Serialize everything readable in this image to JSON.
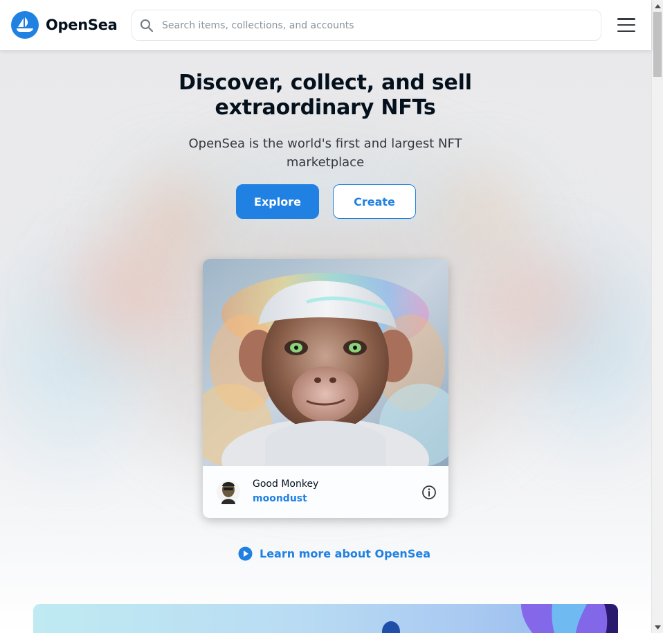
{
  "header": {
    "brand": "OpenSea",
    "search_placeholder": "Search items, collections, and accounts",
    "menu_icon": "hamburger-menu-icon",
    "logo_icon": "opensea-sailboat-icon"
  },
  "hero": {
    "title": "Discover, collect, and sell extraordinary NFTs",
    "subtitle": "OpenSea is the world's first and largest NFT marketplace",
    "explore_label": "Explore",
    "create_label": "Create"
  },
  "featured": {
    "name": "Good Monkey",
    "creator": "moondust",
    "info_icon": "info-icon"
  },
  "learn_more": {
    "label": "Learn more about OpenSea",
    "icon": "play-circle-icon"
  },
  "colors": {
    "accent": "#2081e2",
    "text": "#04111d",
    "subtext": "#353840"
  }
}
